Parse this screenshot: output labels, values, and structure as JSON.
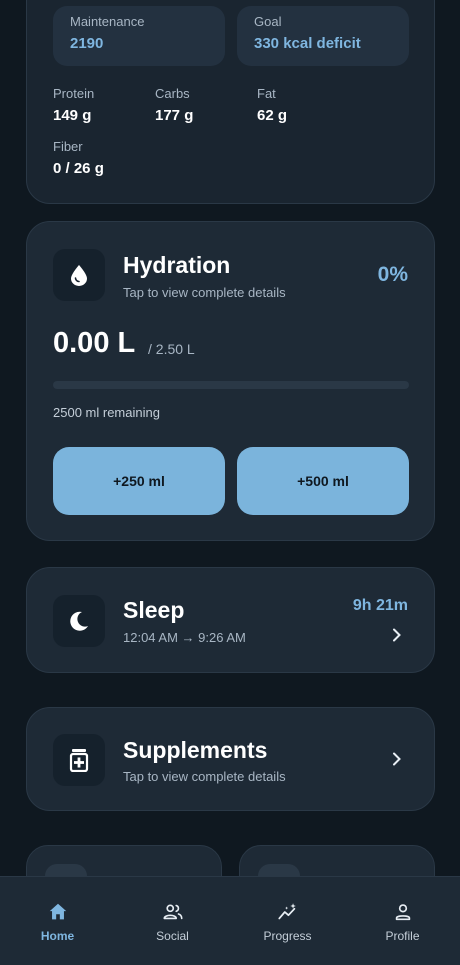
{
  "nutrition": {
    "maintenance": {
      "label": "Maintenance",
      "value": "2190"
    },
    "goal": {
      "label": "Goal",
      "value": "330 kcal deficit"
    },
    "macros": [
      {
        "label": "Protein",
        "value": "149 g"
      },
      {
        "label": "Carbs",
        "value": "177 g"
      },
      {
        "label": "Fat",
        "value": "62 g"
      },
      {
        "label": "Fiber",
        "value": "0 / 26 g"
      }
    ]
  },
  "hydration": {
    "icon": "water-drop-icon",
    "title": "Hydration",
    "subtitle": "Tap to view complete details",
    "percent": "0%",
    "progress": 0,
    "amount": "0.00 L",
    "goal": "/ 2.50 L",
    "remaining": "2500 ml remaining",
    "buttons": [
      "+250 ml",
      "+500 ml"
    ]
  },
  "sleep": {
    "icon": "moon-icon",
    "title": "Sleep",
    "time_range": "12:04 AM → 9:26 AM",
    "duration": "9h 21m"
  },
  "supplements": {
    "icon": "medicine-bottle-icon",
    "title": "Supplements",
    "subtitle": "Tap to view complete details"
  },
  "nav": {
    "items": [
      {
        "label": "Home",
        "icon": "home-icon",
        "active": true
      },
      {
        "label": "Social",
        "icon": "people-icon",
        "active": false
      },
      {
        "label": "Progress",
        "icon": "trending-icon",
        "active": false
      },
      {
        "label": "Profile",
        "icon": "person-icon",
        "active": false
      }
    ]
  },
  "colors": {
    "background": "#0f1820",
    "card": "#1e2a36",
    "accent": "#7fb6e0",
    "button": "#7bb4dc"
  }
}
